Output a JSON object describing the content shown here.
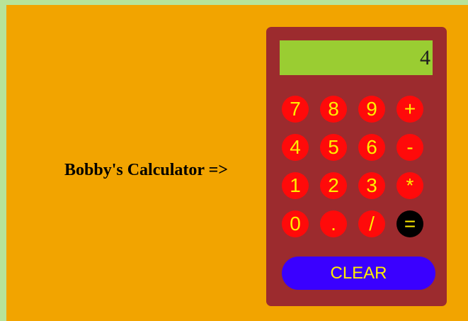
{
  "page": {
    "title": "Bobby's Calculator =>"
  },
  "calculator": {
    "display_value": "4",
    "keys": [
      [
        "7",
        "8",
        "9",
        "+"
      ],
      [
        "4",
        "5",
        "6",
        "-"
      ],
      [
        "1",
        "2",
        "3",
        "*"
      ],
      [
        "0",
        ".",
        "/",
        "="
      ]
    ],
    "clear_label": "CLEAR"
  },
  "colors": {
    "outer_background": "#b7e39a",
    "page_background": "#f2a400",
    "calculator_body": "#9c2b2e",
    "display_background": "#9acd32",
    "key_background": "#ff0a0a",
    "key_text": "#ffee00",
    "equals_background": "#000000",
    "clear_background": "#3a00ff"
  }
}
